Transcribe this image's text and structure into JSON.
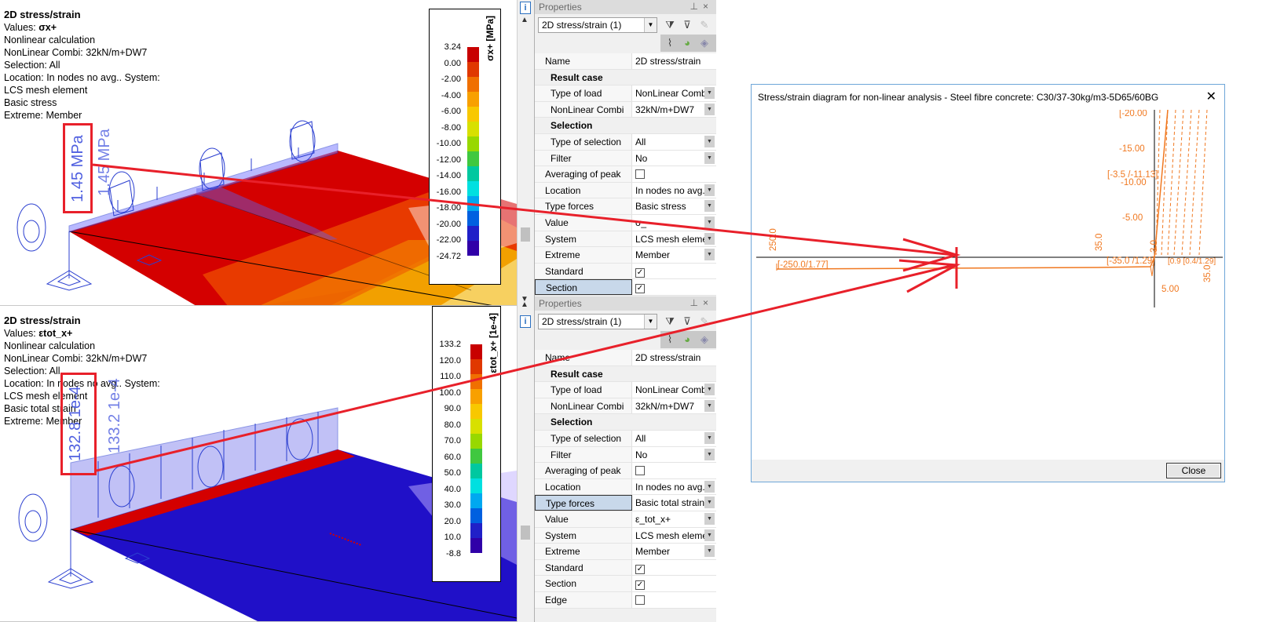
{
  "top_view": {
    "title": "2D stress/strain",
    "values_label": "Values: ",
    "values_sym": "σx+",
    "calc": "Nonlinear calculation",
    "combi": "NonLinear Combi: 32kN/m+DW7",
    "selection": "Selection: All",
    "location": "Location: In nodes no avg.. System:",
    "system": "LCS mesh element",
    "type": "Basic stress",
    "extreme": "Extreme: Member",
    "ann_left": "1.45 MPa",
    "ann_right": "1.45 MPa",
    "legend": {
      "unit": "σx+ [MPa]",
      "labels": [
        "3.24",
        "0.00",
        "-2.00",
        "-4.00",
        "-6.00",
        "-8.00",
        "-10.00",
        "-12.00",
        "-14.00",
        "-16.00",
        "-18.00",
        "-20.00",
        "-22.00",
        "-24.72"
      ]
    }
  },
  "bottom_view": {
    "title": "2D stress/strain",
    "values_label": "Values: ",
    "values_sym": "εtot_x+",
    "calc": "Nonlinear calculation",
    "combi": "NonLinear Combi: 32kN/m+DW7",
    "selection": "Selection: All",
    "location": "Location: In nodes no avg.. System:",
    "system": "LCS mesh element",
    "type": "Basic total strain",
    "extreme": "Extreme: Member",
    "ann_left": "132.8 1e-4",
    "ann_right": "133.2 1e-4",
    "legend": {
      "unit": "εtot_x+ [1e-4]",
      "labels": [
        "133.2",
        "120.0",
        "110.0",
        "100.0",
        "90.0",
        "80.0",
        "70.0",
        "60.0",
        "50.0",
        "40.0",
        "30.0",
        "20.0",
        "10.0",
        "-8.8"
      ]
    }
  },
  "legend_colors": [
    "#c80000",
    "#e03800",
    "#f07000",
    "#f8a000",
    "#f8c800",
    "#d8e000",
    "#98d800",
    "#40c840",
    "#00c8a0",
    "#00e0e0",
    "#00a8f0",
    "#0060e0",
    "#2020c8",
    "#3000a8"
  ],
  "props_top": {
    "title": "Properties",
    "combo": "2D stress/strain (1)",
    "rows": [
      {
        "kind": "row",
        "key": "Name",
        "val": "2D stress/strain"
      },
      {
        "kind": "group",
        "key": "Result case"
      },
      {
        "kind": "row",
        "sub": true,
        "key": "Type of load",
        "val": "NonLinear Comb",
        "dd": true
      },
      {
        "kind": "row",
        "sub": true,
        "key": "NonLinear Combi",
        "val": "32kN/m+DW7",
        "dd": true
      },
      {
        "kind": "group",
        "key": "Selection"
      },
      {
        "kind": "row",
        "sub": true,
        "key": "Type of selection",
        "val": "All",
        "dd": true
      },
      {
        "kind": "row",
        "sub": true,
        "key": "Filter",
        "val": "No",
        "dd": true
      },
      {
        "kind": "row",
        "key": "Averaging of peak",
        "check": ""
      },
      {
        "kind": "row",
        "key": "Location",
        "val": "In nodes no avg.",
        "dd": true
      },
      {
        "kind": "row",
        "key": "Type forces",
        "val": "Basic stress",
        "dd": true
      },
      {
        "kind": "row",
        "key": "Value",
        "val": "σ_",
        "dd": true
      },
      {
        "kind": "row",
        "key": "System",
        "val": "LCS mesh elemen",
        "dd": true
      },
      {
        "kind": "row",
        "key": "Extreme",
        "val": "Member",
        "dd": true
      },
      {
        "kind": "row",
        "key": "Standard",
        "check": "✓"
      },
      {
        "kind": "row",
        "key": "Section",
        "check": "✓",
        "selected": true
      }
    ]
  },
  "props_bot": {
    "title": "Properties",
    "combo": "2D stress/strain (1)",
    "rows": [
      {
        "kind": "row",
        "key": "Name",
        "val": "2D stress/strain"
      },
      {
        "kind": "group",
        "key": "Result case"
      },
      {
        "kind": "row",
        "sub": true,
        "key": "Type of load",
        "val": "NonLinear Comb",
        "dd": true
      },
      {
        "kind": "row",
        "sub": true,
        "key": "NonLinear Combi",
        "val": "32kN/m+DW7",
        "dd": true
      },
      {
        "kind": "group",
        "key": "Selection"
      },
      {
        "kind": "row",
        "sub": true,
        "key": "Type of selection",
        "val": "All",
        "dd": true
      },
      {
        "kind": "row",
        "sub": true,
        "key": "Filter",
        "val": "No",
        "dd": true
      },
      {
        "kind": "row",
        "key": "Averaging of peak",
        "check": ""
      },
      {
        "kind": "row",
        "key": "Location",
        "val": "In nodes no avg.",
        "dd": true
      },
      {
        "kind": "row",
        "key": "Type forces",
        "val": "Basic total strain",
        "dd": true,
        "selected": true
      },
      {
        "kind": "row",
        "key": "Value",
        "val": "ε_tot_x+",
        "dd": true
      },
      {
        "kind": "row",
        "key": "System",
        "val": "LCS mesh elemen",
        "dd": true
      },
      {
        "kind": "row",
        "key": "Extreme",
        "val": "Member",
        "dd": true
      },
      {
        "kind": "row",
        "key": "Standard",
        "check": "✓"
      },
      {
        "kind": "row",
        "key": "Section",
        "check": "✓"
      },
      {
        "kind": "row",
        "key": "Edge",
        "check": ""
      }
    ]
  },
  "dialog": {
    "title": "Stress/strain diagram for non-linear analysis - Steel fibre concrete: C30/37-30kg/m3-5D65/60BG",
    "close_label": "Close",
    "close_x": "✕",
    "labels": {
      "top_pt": "[-20.00",
      "m15": "-15.00",
      "pt_3_5": "[-3.5 /-11.13]",
      "m10": "-10.00",
      "m5": "-5.00",
      "pos5": "5.00",
      "tick250": "250.0",
      "tick35": "35.0",
      "tick3": "3.0",
      "pt_250": "[-250.0/1.77]",
      "pt_35": "[-35.0 /1.29]",
      "right_stack": "[0.9 [0.4/1.29]",
      "right_35": "35.0"
    }
  },
  "colors": {
    "red_arrow": "#e8202a",
    "curve": "#f07820",
    "mesh_blue": "#2b3fd0",
    "stress_red": "#d40000",
    "strain_blue": "#2010c8"
  }
}
